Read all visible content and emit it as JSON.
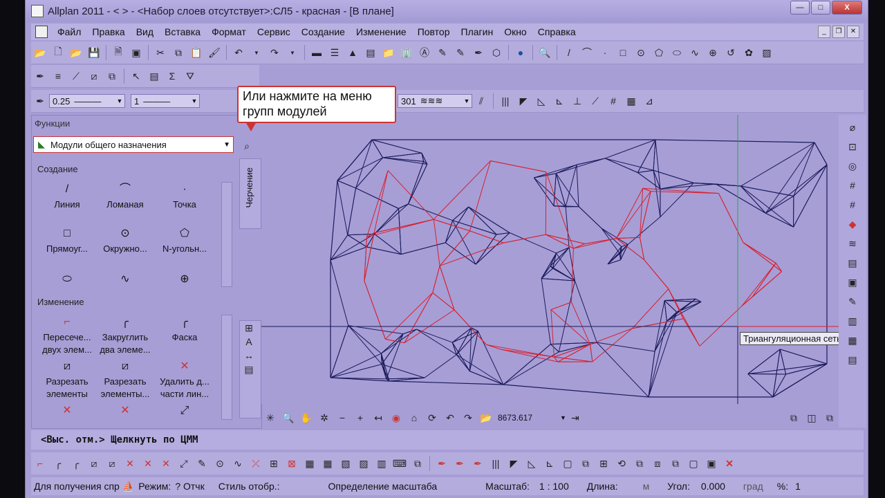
{
  "window": {
    "title": "Allplan 2011 - <     > - <Набор слоев отсутствует>:СЛ5 - красная - [В плане]",
    "minimize": "—",
    "maximize": "□",
    "close": "X"
  },
  "menu": [
    "Файл",
    "Правка",
    "Вид",
    "Вставка",
    "Формат",
    "Сервис",
    "Создание",
    "Изменение",
    "Повтор",
    "Плагин",
    "Окно",
    "Справка"
  ],
  "properties": {
    "pen_label": "0.25",
    "line_label": "1",
    "hatch_label": "301"
  },
  "callout": {
    "text": "Или нажмите на меню групп модулей"
  },
  "panel": {
    "title": "Функции",
    "module_group": "Модули общего назначения",
    "vtab_label": "Черчение",
    "sections": [
      {
        "title": "Создание",
        "tools": [
          {
            "glyph": "/",
            "label": "Линия"
          },
          {
            "glyph": "⌒",
            "label": "Ломаная"
          },
          {
            "glyph": "·",
            "label": "Точка"
          },
          {
            "glyph": "□",
            "label": "Прямоуг..."
          },
          {
            "glyph": "⊙",
            "label": "Окружно..."
          },
          {
            "glyph": "⬠",
            "label": "N-угольн..."
          },
          {
            "glyph": "⬭",
            "label": ""
          },
          {
            "glyph": "∿",
            "label": ""
          },
          {
            "glyph": "⊕",
            "label": ""
          }
        ]
      },
      {
        "title": "Изменение",
        "tools": [
          {
            "glyph": "⌐",
            "label": "Пересече... двух элем..."
          },
          {
            "glyph": "╭",
            "label": "Закруглить два элеме..."
          },
          {
            "glyph": "╭",
            "label": "Фаска"
          },
          {
            "glyph": "⧄",
            "label": "Разрезать элементы"
          },
          {
            "glyph": "⧄",
            "label": "Разрезать элементы..."
          },
          {
            "glyph": "✕",
            "label": "Удалить д... части лин..."
          },
          {
            "glyph": "✕",
            "label": ""
          },
          {
            "glyph": "✕",
            "label": ""
          },
          {
            "glyph": "⤢",
            "label": ""
          }
        ]
      }
    ]
  },
  "tooltip": "Триангуляционная сеть",
  "nav": {
    "coord": "8673.617"
  },
  "prompt": "<Выс. отм.> Щелкнуть по ЦММ",
  "status": {
    "help": "Для получения спр",
    "mode_label": "Режим:",
    "mode_value": "? Отчк",
    "style_label": "Стиль отобр.:",
    "scale_def": "Определение масштаба",
    "scale_label": "Масштаб:",
    "scale_value": "1 : 100",
    "length_label": "Длина:",
    "length_unit": "м",
    "angle_label": "Угол:",
    "angle_value": "0.000",
    "angle_unit": "град",
    "percent_label": "%:",
    "percent_value": "1"
  },
  "colors": {
    "mesh_dark": "#1a1a5a",
    "mesh_red": "#d8202e",
    "crosshair_green": "#1faa4a",
    "accent": "#c33"
  }
}
